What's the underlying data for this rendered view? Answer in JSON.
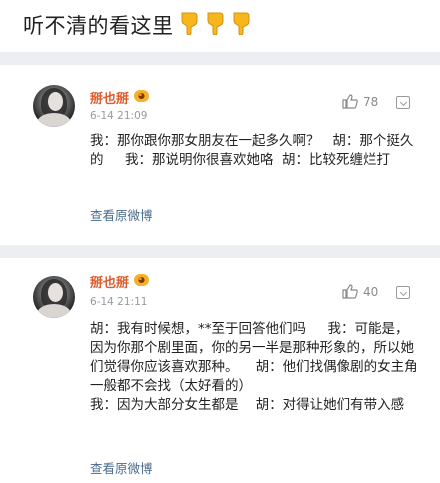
{
  "header": {
    "title": "听不清的看这里",
    "hand_icons": [
      "pointing-down-hand-icon",
      "pointing-down-hand-icon",
      "pointing-down-hand-icon"
    ]
  },
  "colors": {
    "background": "#ffffff",
    "band": "#eceef2",
    "username": "#e05b2c",
    "link": "#4a6b8c",
    "meta": "#9a9a9a",
    "hand_emoji": "#f5b61e"
  },
  "comments": [
    {
      "username": "掰也掰",
      "time": "6-14 21:09",
      "likes": "78",
      "text": "我：那你跟你那女朋友在一起多久啊？   胡：那个挺久的     我：那说明你很喜欢她咯  胡：比较死缠烂打",
      "link": "查看原微博"
    },
    {
      "username": "掰也掰",
      "time": "6-14 21:11",
      "likes": "40",
      "text": "胡：我有时候想，**至于回答他们吗     我：可能是，因为你那个剧里面，你的另一半是那种形象的，所以她们觉得你应该喜欢那种。    胡：他们找偶像剧的女主角一般都不会找（太好看的）\n我：因为大部分女生都是    胡：对得让她们有带入感",
      "link": "查看原微博"
    }
  ]
}
